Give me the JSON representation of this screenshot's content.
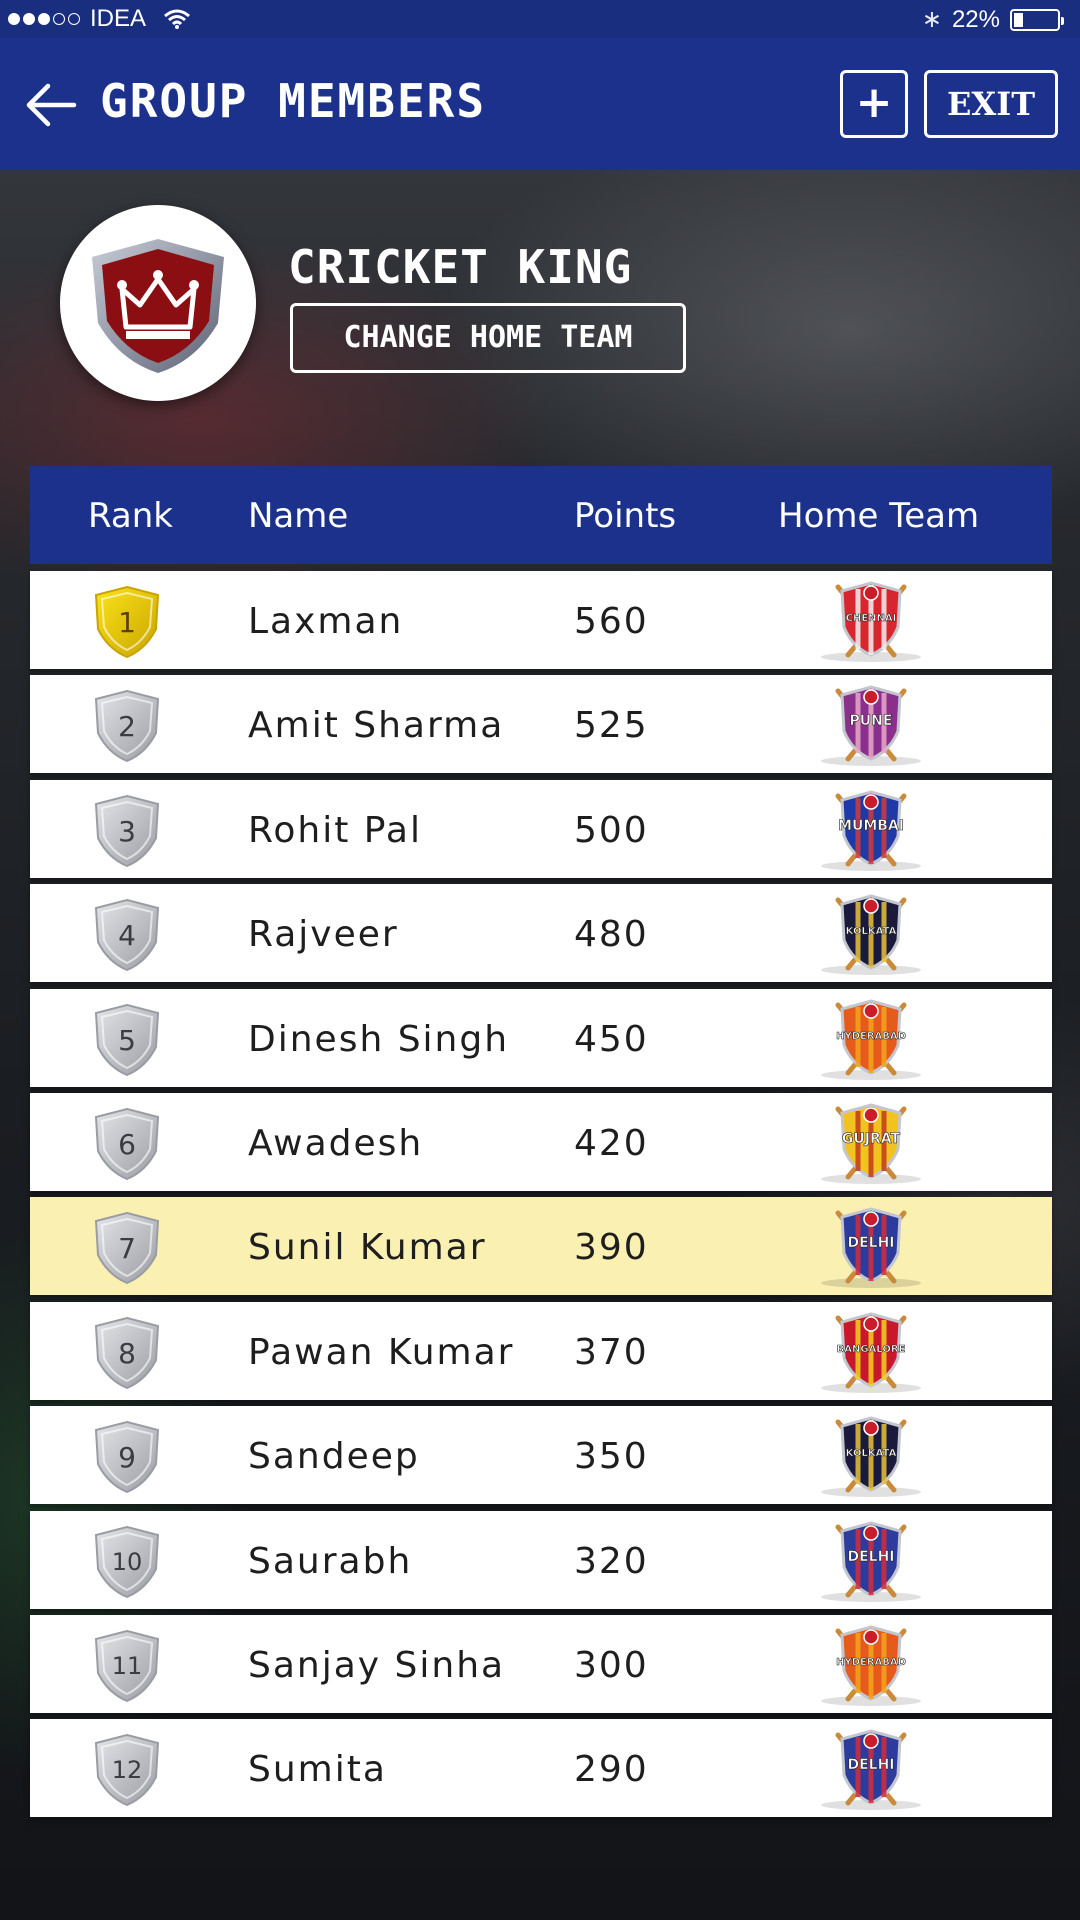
{
  "status_bar": {
    "carrier": "IDEA",
    "battery": "22%",
    "battery_level": 0.22
  },
  "header": {
    "title": "GROUP MEMBERS",
    "add_label": "+",
    "exit_label": "EXIT"
  },
  "group": {
    "name": "CRICKET KING",
    "change_team_label": "CHANGE HOME TEAM"
  },
  "table": {
    "columns": [
      "Rank",
      "Name",
      "Points",
      "Home Team"
    ],
    "rows": [
      {
        "rank": "1",
        "name": "Laxman",
        "points": "560",
        "team": "CHENNAI",
        "team_colors": [
          "#d8262e",
          "#f0f0f0"
        ],
        "gold": true
      },
      {
        "rank": "2",
        "name": "Amit Sharma",
        "points": "525",
        "team": "PUNE",
        "team_colors": [
          "#8a2f8c",
          "#e7a8c9"
        ]
      },
      {
        "rank": "3",
        "name": "Rohit Pal",
        "points": "500",
        "team": "MUMBAI",
        "team_colors": [
          "#1f3aa6",
          "#d23a3a"
        ]
      },
      {
        "rank": "4",
        "name": "Rajveer",
        "points": "480",
        "team": "KOLKATA",
        "team_colors": [
          "#1a1a3d",
          "#e8c23a"
        ]
      },
      {
        "rank": "5",
        "name": "Dinesh Singh",
        "points": "450",
        "team": "HYDERABAD",
        "team_colors": [
          "#e65b1c",
          "#f2a41e"
        ]
      },
      {
        "rank": "6",
        "name": "Awadesh",
        "points": "420",
        "team": "GUJRAT",
        "team_colors": [
          "#f2c21e",
          "#c13a1f"
        ]
      },
      {
        "rank": "7",
        "name": "Sunil Kumar",
        "points": "390",
        "team": "DELHI",
        "team_colors": [
          "#2b3c9e",
          "#d62b3a"
        ],
        "highlight": true
      },
      {
        "rank": "8",
        "name": "Pawan Kumar",
        "points": "370",
        "team": "BANGALORE",
        "team_colors": [
          "#c9182b",
          "#f2d21e"
        ]
      },
      {
        "rank": "9",
        "name": "Sandeep",
        "points": "350",
        "team": "KOLKATA",
        "team_colors": [
          "#1a1a3d",
          "#e8c23a"
        ]
      },
      {
        "rank": "10",
        "name": "Saurabh",
        "points": "320",
        "team": "DELHI",
        "team_colors": [
          "#2b3c9e",
          "#d62b3a"
        ]
      },
      {
        "rank": "11",
        "name": "Sanjay Sinha",
        "points": "300",
        "team": "HYDERABAD",
        "team_colors": [
          "#e65b1c",
          "#f2a41e"
        ]
      },
      {
        "rank": "12",
        "name": "Sumita",
        "points": "290",
        "team": "DELHI",
        "team_colors": [
          "#2b3c9e",
          "#d62b3a"
        ]
      }
    ]
  },
  "colors": {
    "brand_blue": "#1b318c",
    "highlight": "#faf0b1",
    "crest_red": "#8b0f12"
  }
}
